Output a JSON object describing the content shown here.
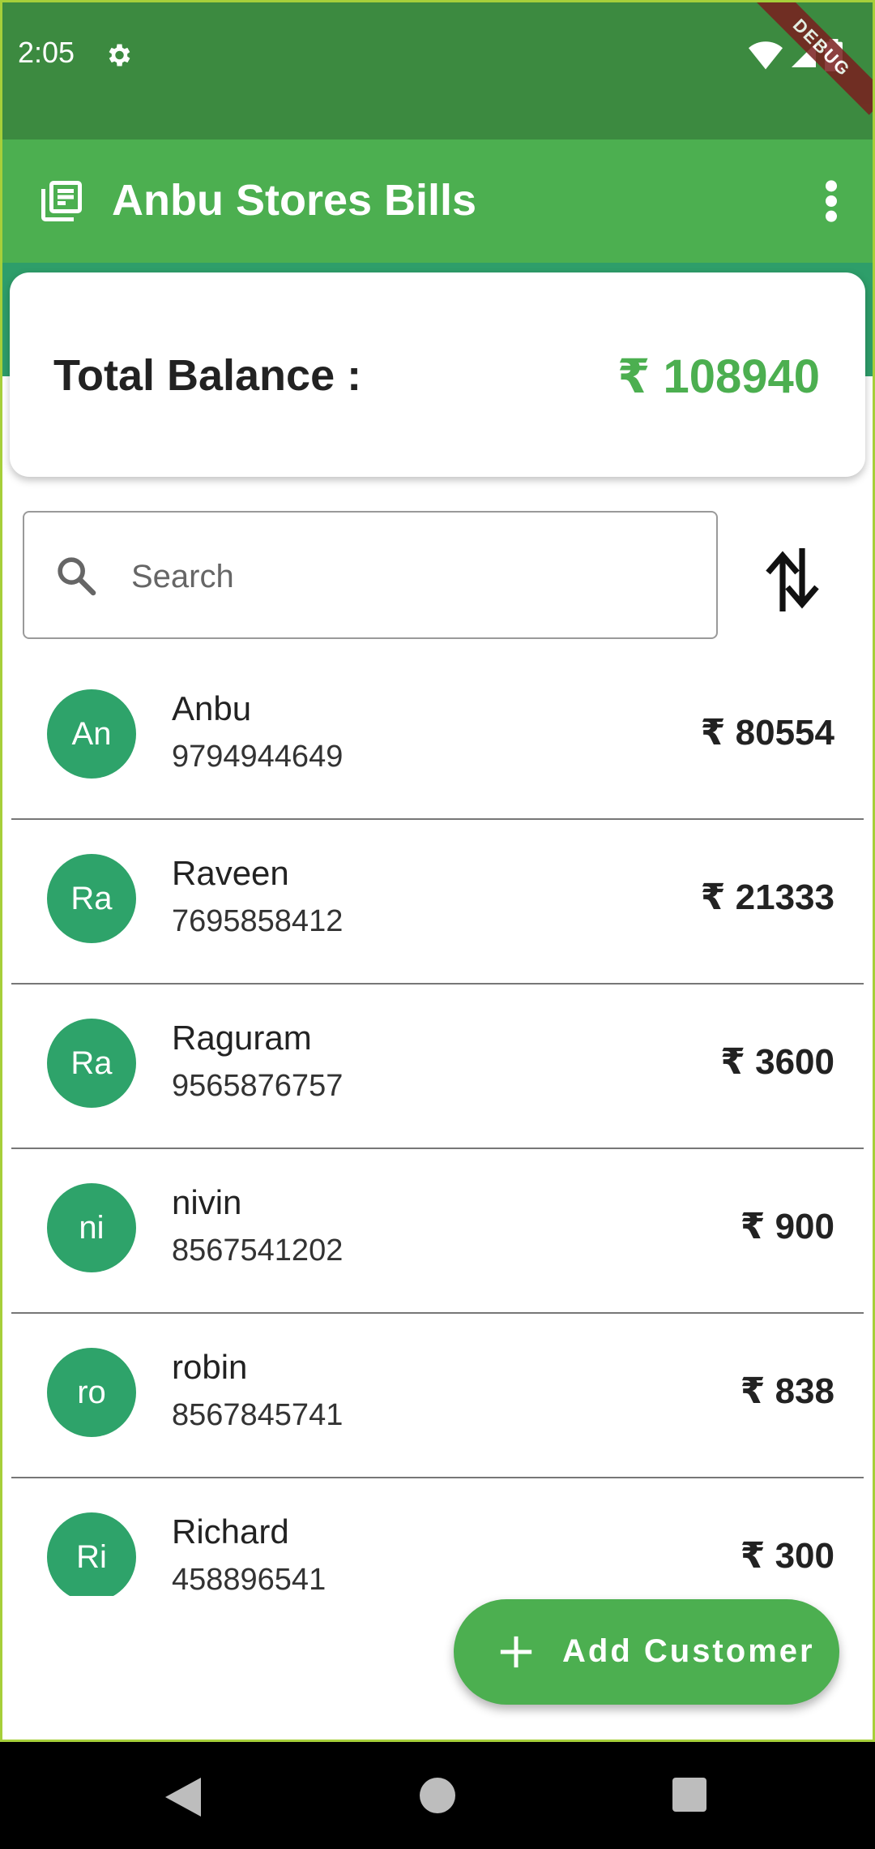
{
  "status_bar": {
    "time": "2:05",
    "debug_label": "DEBUG"
  },
  "app_bar": {
    "title": "Anbu Stores Bills",
    "icon": "receipt-list-icon",
    "menu_icon": "more-vert-icon"
  },
  "balance": {
    "label": "Total Balance :",
    "value": "₹ 108940"
  },
  "search": {
    "placeholder": "Search",
    "value": ""
  },
  "customers": [
    {
      "initials": "An",
      "name": "Anbu",
      "phone": "9794944649",
      "amount": "₹ 80554"
    },
    {
      "initials": "Ra",
      "name": "Raveen",
      "phone": "7695858412",
      "amount": "₹ 21333"
    },
    {
      "initials": "Ra",
      "name": "Raguram",
      "phone": "9565876757",
      "amount": "₹ 3600"
    },
    {
      "initials": "ni",
      "name": "nivin",
      "phone": "8567541202",
      "amount": "₹ 900"
    },
    {
      "initials": "ro",
      "name": "robin",
      "phone": "8567845741",
      "amount": "₹ 838"
    },
    {
      "initials": "Ri",
      "name": "Richard",
      "phone": "458896541",
      "amount": "₹ 300"
    }
  ],
  "fab": {
    "label": "Add Customer"
  },
  "colors": {
    "primary": "#4caf50",
    "status_bar": "#3c8a40",
    "avatar": "#2ea36a"
  }
}
